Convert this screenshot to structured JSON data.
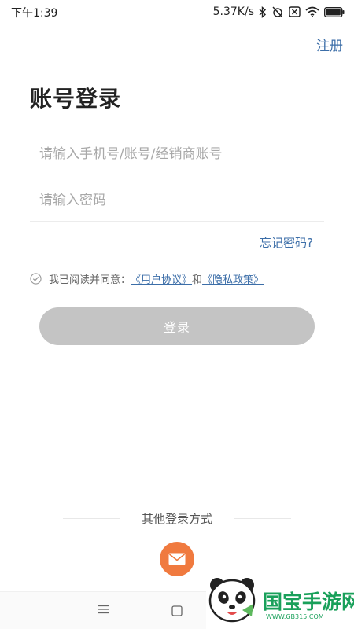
{
  "status_bar": {
    "time": "下午1:39",
    "network_speed": "5.37K/s",
    "icons": [
      "bluetooth-icon",
      "alarm-off-icon",
      "sim-off-icon",
      "wifi-icon",
      "battery-icon"
    ]
  },
  "header": {
    "register_label": "注册",
    "title": "账号登录"
  },
  "form": {
    "account_placeholder": "请输入手机号/账号/经销商账号",
    "account_value": "",
    "password_placeholder": "请输入密码",
    "password_value": "",
    "forgot_label": "忘记密码?"
  },
  "agreement": {
    "prefix": "我已阅读并同意：",
    "user_agreement": "《用户协议》",
    "conjunction": "和",
    "privacy_policy": "《隐私政策》",
    "checked": false
  },
  "login_button": {
    "label": "登录"
  },
  "other_login": {
    "title": "其他登录方式",
    "methods": [
      "mail-icon"
    ]
  },
  "watermark": {
    "text": "国宝手游网",
    "url": "WWW.GB315.COM"
  },
  "colors": {
    "link": "#3c6ea8",
    "login_button_bg": "#c4c4c4",
    "mail_button_bg": "#f07a3f",
    "watermark": "#19a05a"
  }
}
